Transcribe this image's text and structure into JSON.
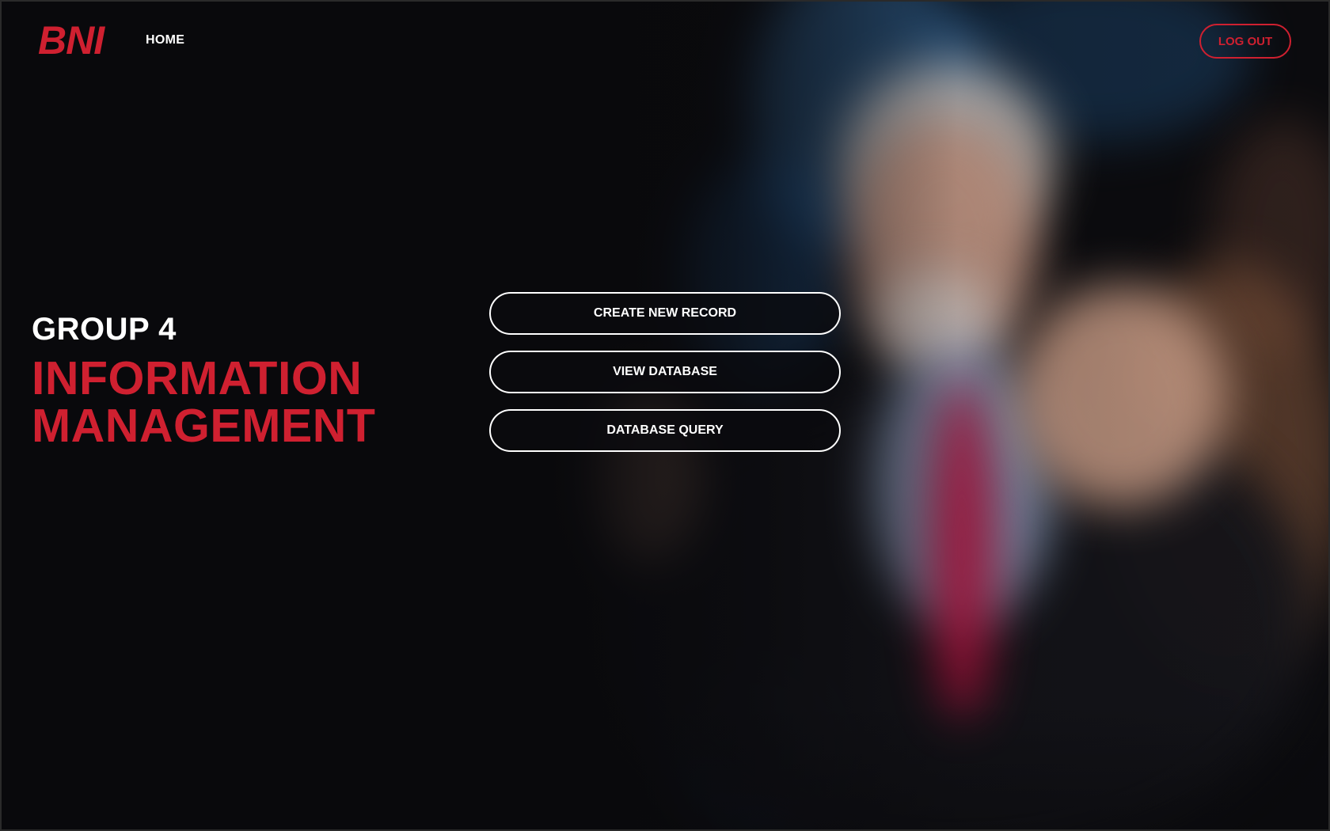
{
  "header": {
    "logo_text": "BNI",
    "nav_home": "HOME",
    "logout_label": "LOG OUT"
  },
  "hero": {
    "group_label": "GROUP 4",
    "title_line1": "INFORMATION",
    "title_line2": "MANAGEMENT"
  },
  "actions": [
    {
      "label": "CREATE NEW RECORD"
    },
    {
      "label": "VIEW DATABASE"
    },
    {
      "label": "DATABASE QUERY"
    }
  ],
  "colors": {
    "brand_red": "#cf2030",
    "background": "#0b0b0e",
    "text_white": "#ffffff"
  }
}
